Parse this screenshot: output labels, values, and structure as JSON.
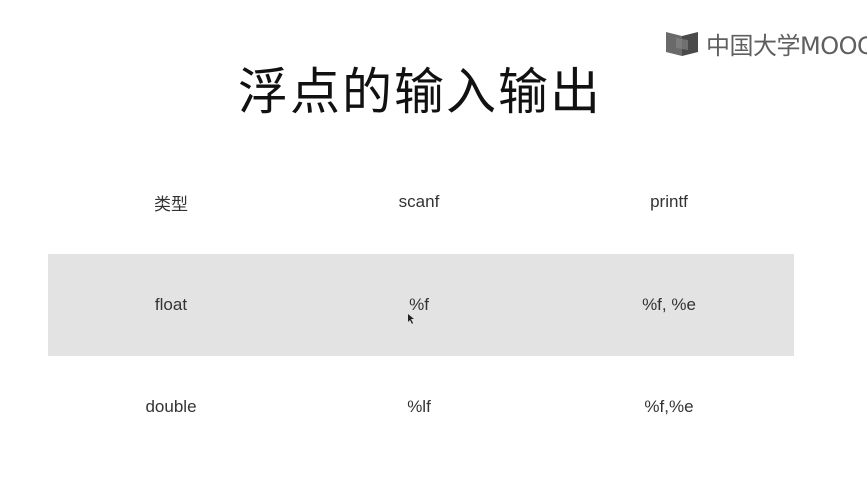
{
  "slide": {
    "title": "浮点的输入输出",
    "watermark": {
      "text": "中国大学MOOC",
      "icon": "mooc-logo-icon"
    },
    "table": {
      "headers": [
        "类型",
        "scanf",
        "printf"
      ],
      "rows": [
        [
          "float",
          "%f",
          "%f, %e"
        ],
        [
          "double",
          "%lf",
          "%f,%e"
        ]
      ]
    }
  }
}
